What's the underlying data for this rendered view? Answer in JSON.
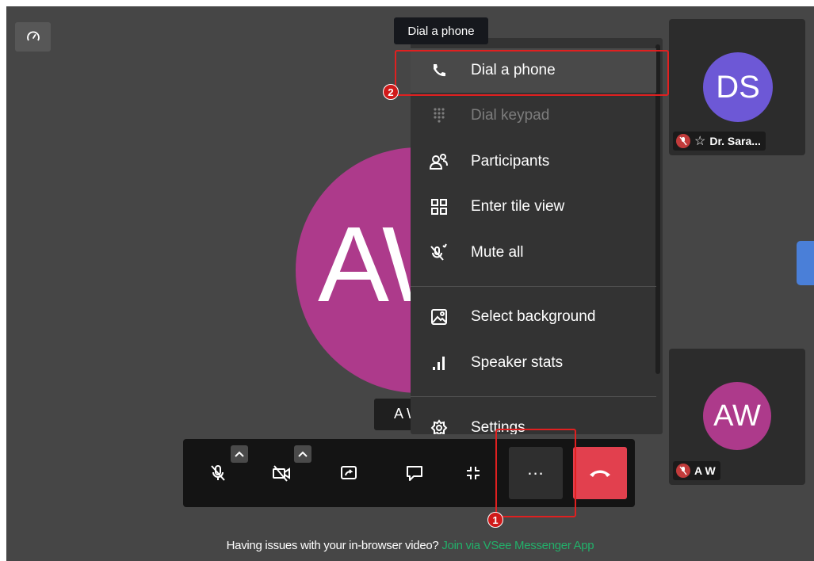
{
  "main_participant": {
    "initials": "AW",
    "name_chip": "A W"
  },
  "participants": [
    {
      "initials": "DS",
      "name": "Dr. Sara...",
      "avatar_color": "#6d58d6",
      "muted": true,
      "starred": true
    },
    {
      "initials": "AW",
      "name": "A W",
      "avatar_color": "#ad3a8b",
      "muted": true,
      "starred": false
    }
  ],
  "tooltip": "Dial a phone",
  "menu": {
    "items": [
      {
        "label": "Dial a phone",
        "icon": "phone-icon",
        "active": true,
        "disabled": false
      },
      {
        "label": "Dial keypad",
        "icon": "keypad-icon",
        "active": false,
        "disabled": true
      },
      {
        "label": "Participants",
        "icon": "participants-icon",
        "active": false,
        "disabled": false
      },
      {
        "label": "Enter tile view",
        "icon": "tile-view-icon",
        "active": false,
        "disabled": false
      },
      {
        "label": "Mute all",
        "icon": "mute-all-icon",
        "active": false,
        "disabled": false
      },
      {
        "label": "Select background",
        "icon": "background-icon",
        "active": false,
        "disabled": false
      },
      {
        "label": "Speaker stats",
        "icon": "stats-icon",
        "active": false,
        "disabled": false
      },
      {
        "label": "Settings",
        "icon": "settings-icon",
        "active": false,
        "disabled": false
      }
    ]
  },
  "toolbar": {
    "buttons": [
      "mic-off-icon",
      "camera-off-icon",
      "screen-share-icon",
      "chat-icon",
      "exit-fullscreen-icon",
      "more-options-icon",
      "hangup-icon"
    ],
    "more_label": "..."
  },
  "annotations": {
    "marker_1": "1",
    "marker_2": "2"
  },
  "footer": {
    "text": "Having issues with your in-browser video?",
    "link": "Join via VSee Messenger App"
  },
  "colors": {
    "accent_red": "#e2404e",
    "link_green": "#22b06a",
    "annotation_red": "#e02020"
  }
}
